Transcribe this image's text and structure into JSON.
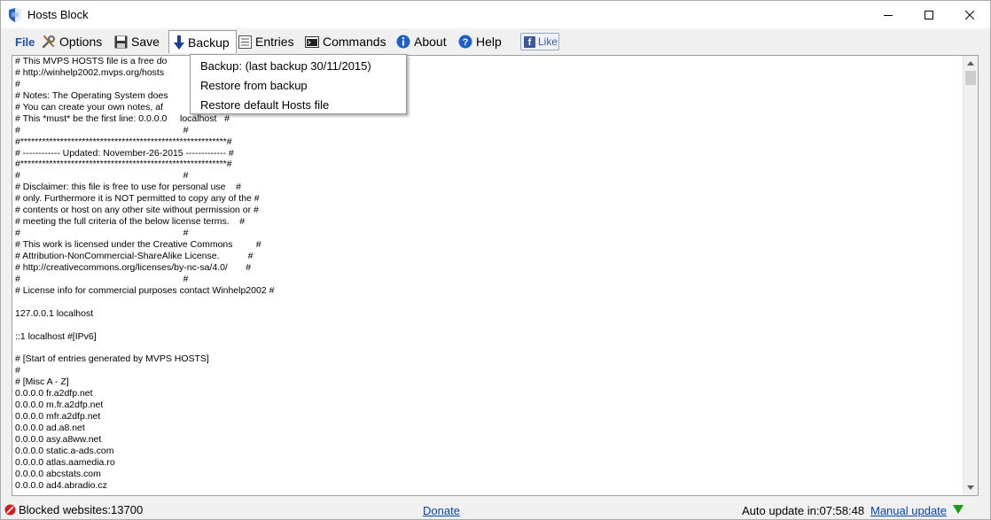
{
  "window": {
    "title": "Hosts Block"
  },
  "menu": {
    "file": "File",
    "options": "Options",
    "save": "Save",
    "backup": "Backup",
    "entries": "Entries",
    "commands": "Commands",
    "about": "About",
    "help": "Help",
    "like": "Like"
  },
  "backup_menu": {
    "item1": "Backup: (last backup 30/11/2015)",
    "item2": "Restore from backup",
    "item3": "Restore default Hosts file"
  },
  "editor": {
    "lines": [
      "# This MVPS HOSTS file is a free do",
      "# http://winhelp2002.mvps.org/hosts",
      "#",
      "# Notes: The Operating System does",
      "# You can create your own notes, af",
      "# This *must* be the first line: 0.0.0.0     localhost   #",
      "#                                                               #",
      "#*********************************************************#",
      "# ------------ Updated: November-26-2015 ------------- #",
      "#*********************************************************#",
      "#                                                               #",
      "# Disclaimer: this file is free to use for personal use    #",
      "# only. Furthermore it is NOT permitted to copy any of the #",
      "# contents or host on any other site without permission or #",
      "# meeting the full criteria of the below license terms.    #",
      "#                                                               #",
      "# This work is licensed under the Creative Commons         #",
      "# Attribution-NonCommercial-ShareAlike License.           #",
      "# http://creativecommons.org/licenses/by-nc-sa/4.0/       #",
      "#                                                               #",
      "# License info for commercial purposes contact Winhelp2002 #",
      "",
      "127.0.0.1 localhost",
      "",
      "::1 localhost #[IPv6]",
      "",
      "# [Start of entries generated by MVPS HOSTS]",
      "#",
      "# [Misc A - Z]",
      "0.0.0.0 fr.a2dfp.net",
      "0.0.0.0 m.fr.a2dfp.net",
      "0.0.0.0 mfr.a2dfp.net",
      "0.0.0.0 ad.a8.net",
      "0.0.0.0 asy.a8ww.net",
      "0.0.0.0 static.a-ads.com",
      "0.0.0.0 atlas.aamedia.ro",
      "0.0.0.0 abcstats.com",
      "0.0.0.0 ad4.abradio.cz"
    ]
  },
  "status": {
    "blocked": "Blocked websites:13700",
    "donate": "Donate",
    "auto_update": "Auto update in:07:58:48",
    "manual_update": "Manual update"
  },
  "colors": {
    "link": "#0645ad",
    "file_menu": "#1a4fb4",
    "facebook": "#3b5998",
    "status_ok": "#1a9a1a",
    "status_blocked": "#d22020"
  },
  "icons": {
    "title": "shield-icon",
    "options": "tools-icon",
    "save": "floppy-icon",
    "backup": "arrow-down-icon",
    "entries": "list-icon",
    "commands": "terminal-icon",
    "about": "info-icon",
    "help": "help-icon"
  }
}
